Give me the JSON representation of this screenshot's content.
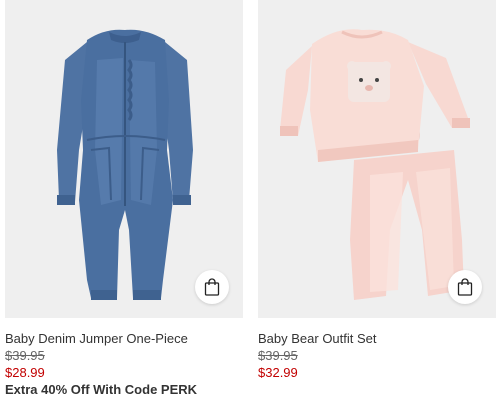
{
  "products": [
    {
      "name": "Baby Denim Jumper One-Piece",
      "original_price": "$39.95",
      "sale_price": "$28.99",
      "promo": "Extra 40% Off With Code PERK",
      "bag_icon": "shopping-bag-icon"
    },
    {
      "name": "Baby Bear Outfit Set",
      "original_price": "$39.95",
      "sale_price": "$32.99",
      "promo": "",
      "bag_icon": "shopping-bag-icon"
    }
  ],
  "colors": {
    "image_bg": "#efefef",
    "sale_price": "#c20000",
    "denim": "#4a6fa0",
    "pink": "#f8d9d2"
  }
}
